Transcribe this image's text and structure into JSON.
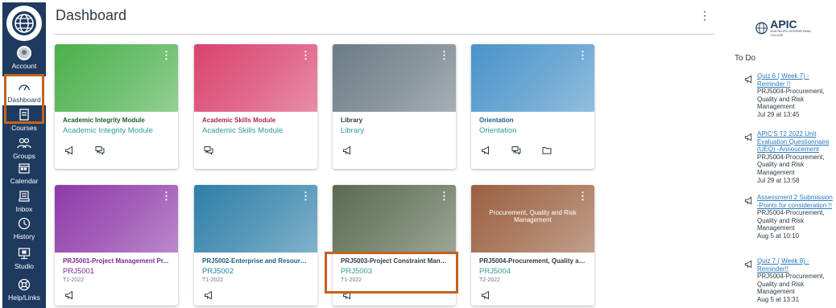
{
  "page_title": "Dashboard",
  "nav": {
    "account": "Account",
    "dashboard": "Dashboard",
    "courses": "Courses",
    "groups": "Groups",
    "calendar": "Calendar",
    "inbox": "Inbox",
    "history": "History",
    "studio": "Studio",
    "help": "Help/Links"
  },
  "cards": [
    {
      "title": "Academic Integrity Module",
      "code": "Academic Integrity Module",
      "term": "",
      "color": "#4bb04b",
      "title_color": "#1b5e20",
      "code_color": "#2d9c9c",
      "icons": [
        "announcement-icon",
        "discussion-icon"
      ]
    },
    {
      "title": "Academic Skills Module",
      "code": "Academic Skills Module",
      "term": "",
      "color": "#d9436e",
      "title_color": "#b0244b",
      "code_color": "#2d9c9c",
      "icons": [
        "discussion-icon"
      ]
    },
    {
      "title": "Library",
      "code": "Library",
      "term": "",
      "color": "#6b7b85",
      "title_color": "#2d3b45",
      "code_color": "#2d9c9c",
      "icons": [
        "announcement-icon"
      ]
    },
    {
      "title": "Orientation",
      "code": "Orientation",
      "term": "",
      "color": "#4a93c9",
      "title_color": "#1e5f8f",
      "code_color": "#2d9c9c",
      "icons": [
        "announcement-icon",
        "discussion-icon",
        "files-icon"
      ]
    },
    {
      "title": "PRJ5001-Project Management Pr...",
      "code": "PRJ5001",
      "term": "T1-2022",
      "color": "#8e3aa8",
      "title_color": "#7a2a93",
      "code_color": "#7a2a93",
      "icons": [
        "announcement-icon"
      ]
    },
    {
      "title": "PRJ5002-Enterprise and Resource...",
      "code": "PRJ5002",
      "term": "T1-2022",
      "color": "#2e7fa8",
      "title_color": "#1d5f80",
      "code_color": "#1d7fb3",
      "icons": [
        "announcement-icon"
      ]
    },
    {
      "title": "PRJ5003-Project Constraint Mana...",
      "code": "PRJ5003",
      "term": "T1-2022",
      "color": "#5b6b50",
      "title_color": "#2d3b45",
      "code_color": "#2d9c9c",
      "icons": [
        "announcement-icon"
      ]
    },
    {
      "title": "PRJ5004-Procurement, Quality an...",
      "code": "PRJ5004",
      "term": "T2-2022",
      "color": "#9a6040",
      "title_color": "#2d3b45",
      "code_color": "#2d9c9c",
      "hero_text": "Procurement, Quality and Risk Management",
      "icons": [
        "announcement-icon"
      ]
    }
  ],
  "logo_text": "APIC",
  "logo_sub": "ASIA PACIFIC INTERNATIONAL COLLEGE",
  "todo": {
    "heading": "To Do",
    "items": [
      {
        "link": "Quiz 6 ( Week 7) -Reminder !!",
        "course": "PRJ5004-Procurement, Quality and Risk Management",
        "date": "Jul 29 at 13:45"
      },
      {
        "link": "APIC'S T2 2022 Unit Evaluation Questionnaire (UEQ) -Annoucement",
        "course": "PRJ5004-Procurement, Quality and Risk Management",
        "date": "Jul 29 at 13:58"
      },
      {
        "link": "Assessment 2 Submission -Points for consideration !!",
        "course": "PRJ5004-Procurement, Quality and Risk Management",
        "date": "Aug 5 at 10:10"
      },
      {
        "link": "Quiz 7 ( Week 8) -Reminder!!",
        "course": "PRJ5004-Procurement, Quality and Risk Management",
        "date": "Aug 5 at 13:31"
      }
    ]
  },
  "colors": {
    "nav_bg": "#1e3a5f",
    "highlight": "#c5621d",
    "link": "#2b7abc"
  }
}
